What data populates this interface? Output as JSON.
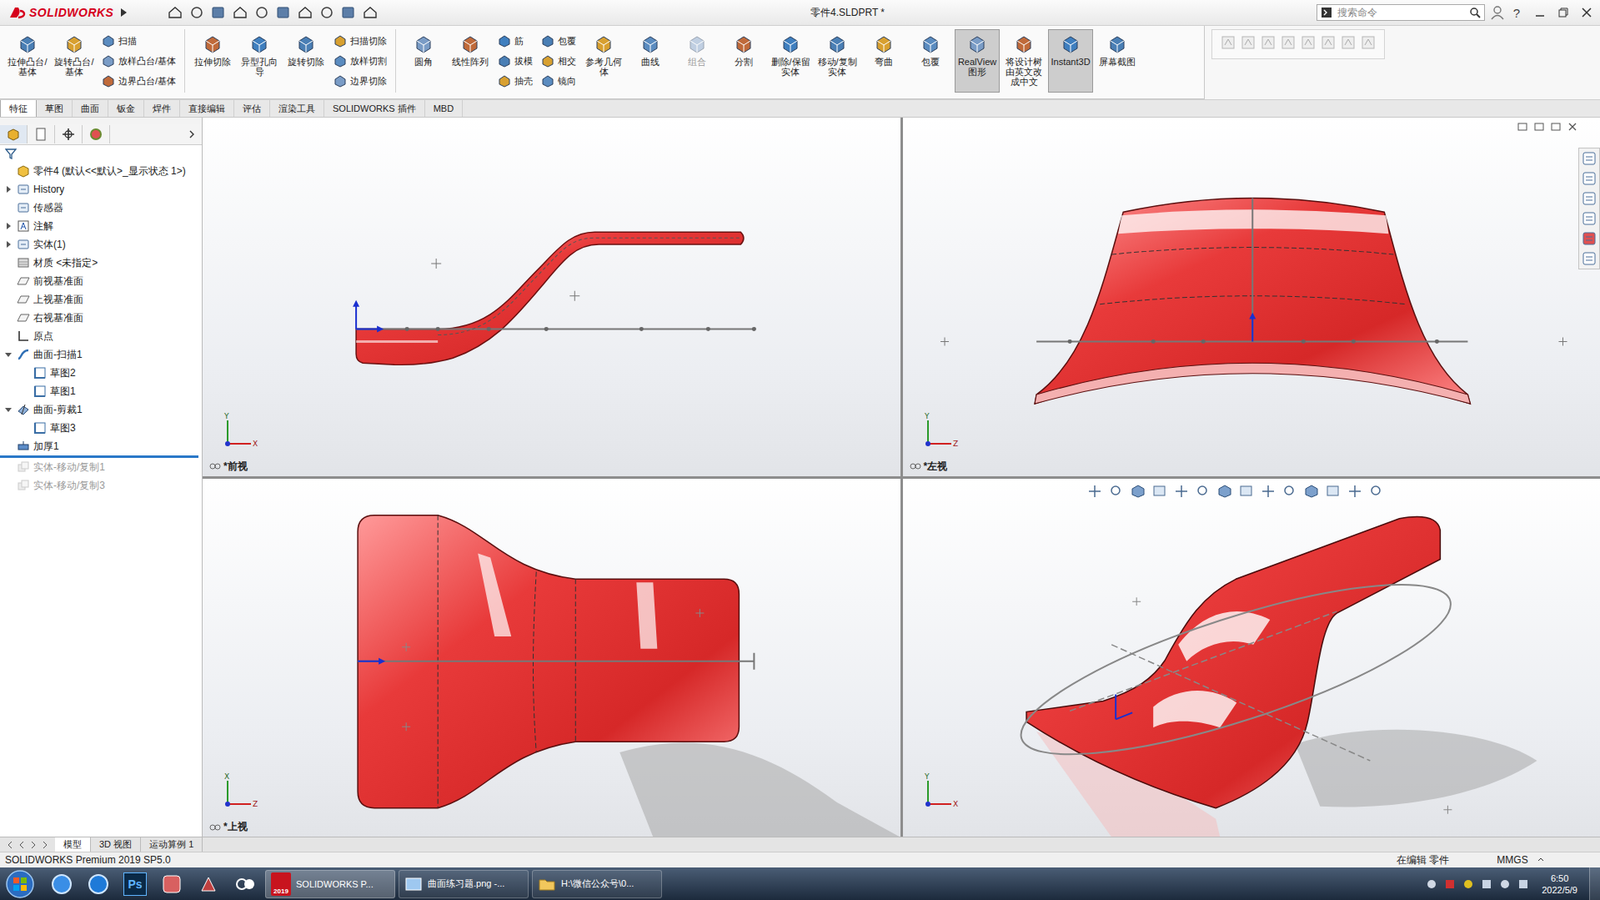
{
  "titlebar": {
    "logo": "SOLIDWORKS",
    "title": "零件4.SLDPRT *",
    "search_placeholder": "搜索命令",
    "help": "?"
  },
  "ribbon": [
    {
      "kind": "large",
      "label": "拉伸凸台/基体",
      "selected": false,
      "disabled": false
    },
    {
      "kind": "large",
      "label": "旋转凸台/基体",
      "selected": false,
      "disabled": false
    },
    {
      "kind": "stack",
      "items": [
        {
          "label": "扫描",
          "disabled": false
        },
        {
          "label": "放样凸台/基体",
          "disabled": false
        },
        {
          "label": "边界凸台/基体",
          "disabled": false
        }
      ]
    },
    {
      "kind": "separator"
    },
    {
      "kind": "large",
      "label": "拉伸切除",
      "selected": false,
      "disabled": false
    },
    {
      "kind": "large",
      "label": "异型孔向导",
      "selected": false,
      "disabled": false
    },
    {
      "kind": "large",
      "label": "旋转切除",
      "selected": false,
      "disabled": false
    },
    {
      "kind": "stack",
      "items": [
        {
          "label": "扫描切除",
          "disabled": false
        },
        {
          "label": "放样切割",
          "disabled": false
        },
        {
          "label": "边界切除",
          "disabled": false
        }
      ]
    },
    {
      "kind": "separator"
    },
    {
      "kind": "large",
      "label": "圆角",
      "selected": false,
      "disabled": false
    },
    {
      "kind": "large",
      "label": "线性阵列",
      "selected": false,
      "disabled": false
    },
    {
      "kind": "stack",
      "items": [
        {
          "label": "筋",
          "disabled": false
        },
        {
          "label": "拔模",
          "disabled": false
        },
        {
          "label": "抽壳",
          "disabled": false
        }
      ]
    },
    {
      "kind": "stack",
      "items": [
        {
          "label": "包覆",
          "disabled": false
        },
        {
          "label": "相交",
          "disabled": false
        },
        {
          "label": "镜向",
          "disabled": false
        }
      ]
    },
    {
      "kind": "large",
      "label": "参考几何体",
      "selected": false,
      "disabled": false
    },
    {
      "kind": "large",
      "label": "曲线",
      "selected": false,
      "disabled": false
    },
    {
      "kind": "large",
      "label": "组合",
      "selected": false,
      "disabled": true
    },
    {
      "kind": "large",
      "label": "分割",
      "selected": false,
      "disabled": false
    },
    {
      "kind": "large",
      "label": "删除/保留实体",
      "selected": false,
      "disabled": false
    },
    {
      "kind": "large",
      "label": "移动/复制实体",
      "selected": false,
      "disabled": false
    },
    {
      "kind": "large",
      "label": "弯曲",
      "selected": false,
      "disabled": false
    },
    {
      "kind": "large",
      "label": "包覆",
      "selected": false,
      "disabled": false
    },
    {
      "kind": "large",
      "label": "RealView 图形",
      "selected": true,
      "disabled": false
    },
    {
      "kind": "large",
      "label": "将设计树由英文改成中文",
      "selected": false,
      "disabled": false
    },
    {
      "kind": "large",
      "label": "Instant3D",
      "selected": true,
      "disabled": false
    },
    {
      "kind": "large",
      "label": "屏幕截图",
      "selected": false,
      "disabled": false
    }
  ],
  "tabs": [
    {
      "label": "特征",
      "selected": true
    },
    {
      "label": "草图",
      "selected": false
    },
    {
      "label": "曲面",
      "selected": false
    },
    {
      "label": "钣金",
      "selected": false
    },
    {
      "label": "焊件",
      "selected": false
    },
    {
      "label": "直接编辑",
      "selected": false
    },
    {
      "label": "评估",
      "selected": false
    },
    {
      "label": "渲染工具",
      "selected": false
    },
    {
      "label": "SOLIDWORKS 插件",
      "selected": false
    },
    {
      "label": "MBD",
      "selected": false
    }
  ],
  "panel_tabs": [
    {
      "kind": "feature",
      "selected": true
    },
    {
      "kind": "property",
      "selected": false
    },
    {
      "kind": "config",
      "selected": false
    },
    {
      "kind": "display",
      "selected": false
    }
  ],
  "tree": [
    {
      "label": "零件4 (默认<<默认>_显示状态 1>)",
      "kind": "part",
      "depth": 0,
      "expandable": false,
      "expanded": false,
      "disabled": false,
      "rollback_below": false
    },
    {
      "label": "History",
      "kind": "history",
      "depth": 0,
      "expandable": true,
      "expanded": false,
      "disabled": false,
      "rollback_below": false
    },
    {
      "label": "传感器",
      "kind": "sensor",
      "depth": 0,
      "expandable": false,
      "expanded": false,
      "disabled": false,
      "rollback_below": false
    },
    {
      "label": "注解",
      "kind": "annotation",
      "depth": 0,
      "expandable": true,
      "expanded": false,
      "disabled": false,
      "rollback_below": false
    },
    {
      "label": "实体(1)",
      "kind": "solid",
      "depth": 0,
      "expandable": true,
      "expanded": false,
      "disabled": false,
      "rollback_below": false
    },
    {
      "label": "材质 <未指定>",
      "kind": "material",
      "depth": 0,
      "expandable": false,
      "expanded": false,
      "disabled": false,
      "rollback_below": false
    },
    {
      "label": "前视基准面",
      "kind": "plane",
      "depth": 0,
      "expandable": false,
      "expanded": false,
      "disabled": false,
      "rollback_below": false
    },
    {
      "label": "上视基准面",
      "kind": "plane",
      "depth": 0,
      "expandable": false,
      "expanded": false,
      "disabled": false,
      "rollback_below": false
    },
    {
      "label": "右视基准面",
      "kind": "plane",
      "depth": 0,
      "expandable": false,
      "expanded": false,
      "disabled": false,
      "rollback_below": false
    },
    {
      "label": "原点",
      "kind": "origin",
      "depth": 0,
      "expandable": false,
      "expanded": false,
      "disabled": false,
      "rollback_below": false
    },
    {
      "label": "曲面-扫描1",
      "kind": "sweep",
      "depth": 0,
      "expandable": true,
      "expanded": true,
      "disabled": false,
      "rollback_below": false
    },
    {
      "label": "草图2",
      "kind": "sketch",
      "depth": 1,
      "expandable": false,
      "expanded": false,
      "disabled": false,
      "rollback_below": false
    },
    {
      "label": "草图1",
      "kind": "sketch",
      "depth": 1,
      "expandable": false,
      "expanded": false,
      "disabled": false,
      "rollback_below": false
    },
    {
      "label": "曲面-剪裁1",
      "kind": "trim",
      "depth": 0,
      "expandable": true,
      "expanded": true,
      "disabled": false,
      "rollback_below": false
    },
    {
      "label": "草图3",
      "kind": "sketch",
      "depth": 1,
      "expandable": false,
      "expanded": false,
      "disabled": false,
      "rollback_below": false
    },
    {
      "label": "加厚1",
      "kind": "thicken",
      "depth": 0,
      "expandable": false,
      "expanded": false,
      "disabled": false,
      "rollback_below": true
    },
    {
      "label": "实体-移动/复制1",
      "kind": "move",
      "depth": 0,
      "expandable": false,
      "expanded": false,
      "disabled": true,
      "rollback_below": false
    },
    {
      "label": "实体-移动/复制3",
      "kind": "move",
      "depth": 0,
      "expandable": false,
      "expanded": false,
      "disabled": true,
      "rollback_below": false
    }
  ],
  "viewports": [
    {
      "view": "front",
      "label": "*前视",
      "axes": [
        "Y",
        "X"
      ]
    },
    {
      "view": "left",
      "label": "*左视",
      "axes": [
        "Y",
        "Z"
      ]
    },
    {
      "view": "top",
      "label": "*上视",
      "axes": [
        "X",
        "Z"
      ]
    },
    {
      "view": "iso",
      "axes": [
        "Y",
        "X"
      ]
    }
  ],
  "model_tabs": [
    {
      "label": "模型",
      "selected": true
    },
    {
      "label": "3D 视图",
      "selected": false
    },
    {
      "label": "运动算例 1",
      "selected": false
    }
  ],
  "status": {
    "product": "SOLIDWORKS Premium 2019 SP5.0",
    "mode": "在编辑 零件",
    "units": "MMGS"
  },
  "taskbar": {
    "pinned": [
      {
        "kind": "baidu"
      },
      {
        "kind": "ie"
      },
      {
        "kind": "ps",
        "glyph": "Ps"
      },
      {
        "kind": "media"
      },
      {
        "kind": "tool"
      },
      {
        "kind": "recorder"
      }
    ],
    "tasks": [
      {
        "label": "SOLIDWORKS P...",
        "badge": "2019",
        "kind": "solidworks",
        "selected": true
      },
      {
        "label": "曲面练习题.png -...",
        "kind": "image",
        "selected": false
      },
      {
        "label": "H:\\微信公众号\\0...",
        "kind": "folder",
        "selected": false
      }
    ],
    "time": "6:50",
    "date": "2022/5/9"
  }
}
